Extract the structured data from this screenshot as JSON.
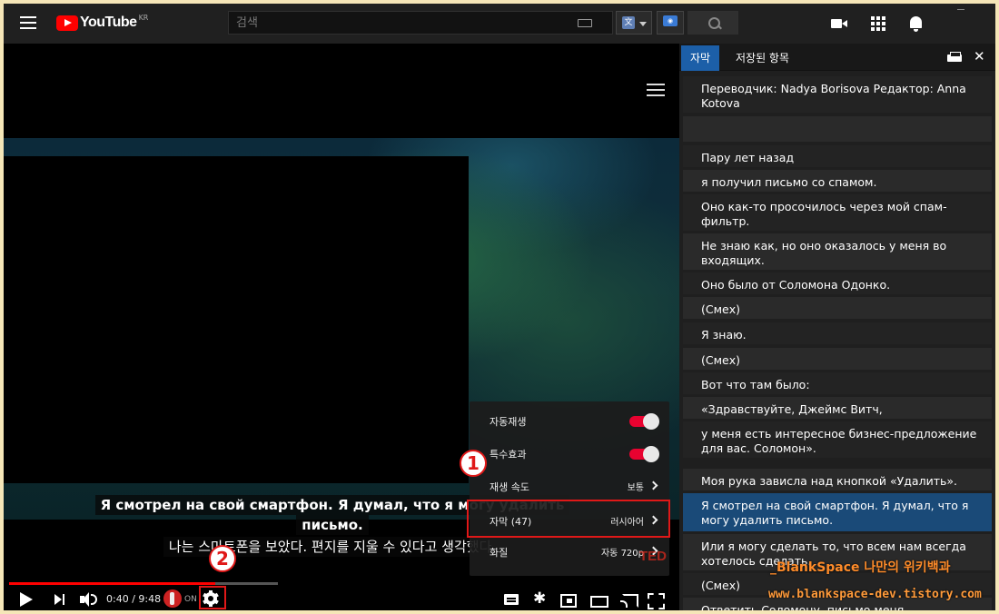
{
  "header": {
    "logo_text": "YouTube",
    "logo_region": "KR",
    "search_placeholder": "검색"
  },
  "player": {
    "subtitle_ru_line1": "Я смотрел на свой смартфон. Я думал, что я могу удалить",
    "subtitle_ru_line2": "письмо.",
    "subtitle_ko": "나는 스마트폰을 보았다. 편지를 지울 수 있다고 생각했다.",
    "time": "0:40 / 9:48",
    "progress_fraction": 0.0697,
    "addon_label": "ON",
    "ted_logo": "TED"
  },
  "settings": {
    "items": [
      {
        "label": "자동재생",
        "value": "",
        "type": "toggle",
        "on": true
      },
      {
        "label": "특수효과",
        "value": "",
        "type": "toggle",
        "on": true
      },
      {
        "label": "재생 속도",
        "value": "보통",
        "type": "submenu"
      },
      {
        "label": "자막 (47)",
        "value": "러시아어",
        "type": "submenu"
      },
      {
        "label": "화질",
        "value": "자동 720p",
        "type": "submenu"
      }
    ]
  },
  "annotations": {
    "step1": "1",
    "step2": "2"
  },
  "transcript": {
    "tab_active": "자막",
    "tab_saved": "저장된 항목",
    "lines": [
      "Переводчик: Nadya Borisova Редактор: Anna Kotova",
      "",
      "Пару лет назад",
      "я получил письмо со спамом.",
      "Оно как-то просочилось через мой спам-фильтр.",
      "Не знаю как, но оно оказалось у меня во входящих.",
      "Оно было от Соломона Одонко.",
      "(Смех)",
      "Я знаю.",
      "(Смех)",
      "Вот что там было:",
      "«Здравствуйте, Джеймс Витч,",
      "у меня есть интересное бизнес-предложение для вас. Соломон».",
      "Моя рука зависла над кнопкой «Удалить».",
      "Я смотрел на свой смартфон. Я думал, что я могу удалить письмо.",
      "Или я могу сделать то, что всем нам всегда хотелось сделать.",
      "(Смех)",
      "Ответить Соломону, письмо меня"
    ],
    "active_index": 14
  },
  "watermark": {
    "blog_name": "_BlankSpace 나만의 위키백과",
    "blog_url": "www.blankspace-dev.tistory.com"
  }
}
